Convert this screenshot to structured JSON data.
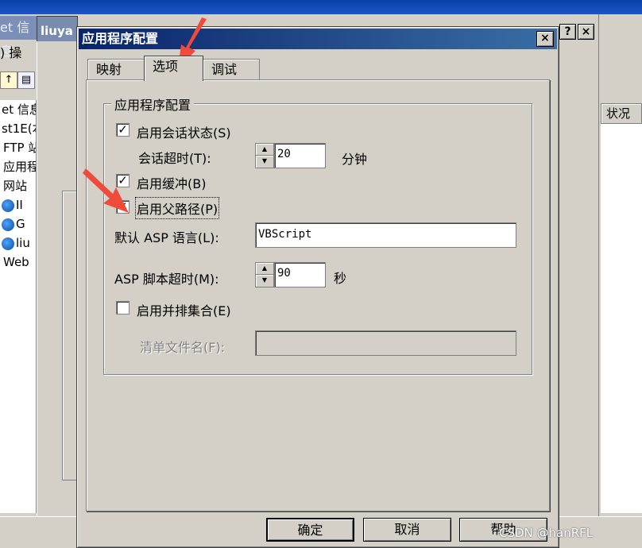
{
  "background_window": {
    "title_left": "et 信息",
    "title_child": "liuya",
    "menu_fragment": ") 操",
    "tree_items": [
      {
        "label": "et 信息",
        "icon": "none"
      },
      {
        "label": "st1E(本",
        "icon": "none"
      },
      {
        "label": "FTP 站",
        "icon": "none"
      },
      {
        "label": "应用程",
        "icon": "none"
      },
      {
        "label": "网站",
        "icon": "none"
      },
      {
        "label": "II",
        "icon": "globe-icon"
      },
      {
        "label": "G",
        "icon": "globe-icon"
      },
      {
        "label": "liu",
        "icon": "globe-icon"
      },
      {
        "label": "Web",
        "icon": "none"
      }
    ],
    "status_column_header": "状况",
    "help_caption_btn": "?",
    "close_caption_btn": "×"
  },
  "dialog": {
    "title": "应用程序配置",
    "close_label": "×",
    "tabs": [
      {
        "label": "映射",
        "active": false
      },
      {
        "label": "选项",
        "active": true
      },
      {
        "label": "调试",
        "active": false
      }
    ],
    "group_title": "应用程序配置",
    "enable_session_state": {
      "label": "启用会话状态(S)",
      "checked": true
    },
    "session_timeout": {
      "label": "会话超时(T):",
      "value": "20",
      "unit": "分钟"
    },
    "enable_buffering": {
      "label": "启用缓冲(B)",
      "checked": true
    },
    "enable_parent_paths": {
      "label": "启用父路径(P)",
      "checked": true
    },
    "default_asp_language": {
      "label": "默认 ASP 语言(L):",
      "value": "VBScript"
    },
    "asp_script_timeout": {
      "label": "ASP 脚本超时(M):",
      "value": "90",
      "unit": "秒"
    },
    "enable_side_by_side": {
      "label": "启用并排集合(E)",
      "checked": false
    },
    "manifest_file_name": {
      "label": "清单文件名(F):",
      "value": ""
    },
    "buttons": {
      "ok": "确定",
      "cancel": "取消",
      "help": "帮助"
    }
  },
  "checkmark": "✓",
  "watermark": "CSDN @hanRFL",
  "colors": {
    "title_bar": "#0a246a",
    "face": "#d4d0c8",
    "arrow": "#f04a3a"
  }
}
